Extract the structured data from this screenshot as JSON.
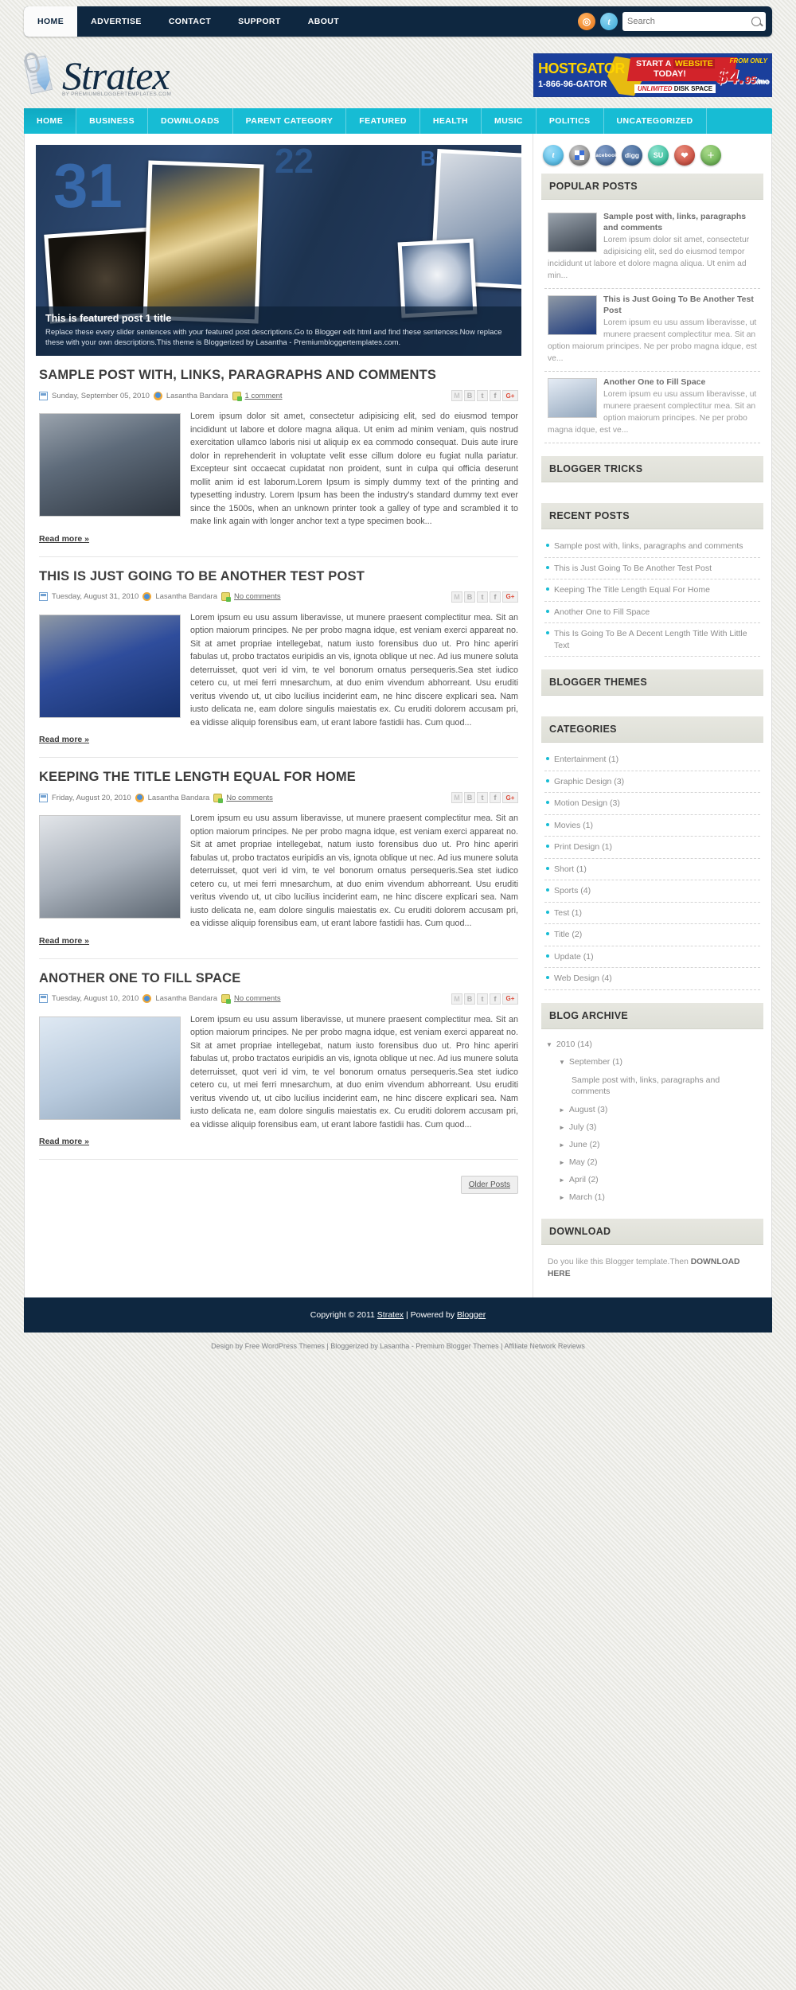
{
  "topbar": {
    "nav": [
      {
        "label": "HOME",
        "active": true
      },
      {
        "label": "ADVERTISE",
        "active": false
      },
      {
        "label": "CONTACT",
        "active": false
      },
      {
        "label": "SUPPORT",
        "active": false
      },
      {
        "label": "ABOUT",
        "active": false
      }
    ],
    "icons": [
      "rss-icon",
      "twitter-icon"
    ],
    "search": {
      "placeholder": "Search",
      "value": ""
    }
  },
  "header": {
    "logo_name": "Stratex",
    "logo_tagline": "BY PREMIUMBLOGGERTEMPLATES.COM",
    "banner": {
      "brand": "HOSTGATOR",
      "phone": "1-866-96-GATOR",
      "headline_1": "START A",
      "headline_highlight": "WEBSITE",
      "headline_2": "TODAY!",
      "sub_1": "UNLIMITED",
      "sub_2": "DISK SPACE",
      "from_only": "FROM ONLY",
      "price": "$4.",
      "cents": "95",
      "per": "/mo"
    }
  },
  "mainnav": [
    {
      "label": "HOME",
      "active": true
    },
    {
      "label": "BUSINESS",
      "active": false
    },
    {
      "label": "DOWNLOADS",
      "active": false
    },
    {
      "label": "PARENT CATEGORY",
      "active": false
    },
    {
      "label": "FEATURED",
      "active": false
    },
    {
      "label": "HEALTH",
      "active": false
    },
    {
      "label": "MUSIC",
      "active": false
    },
    {
      "label": "POLITICS",
      "active": false
    },
    {
      "label": "UNCATEGORIZED",
      "active": false
    }
  ],
  "slider": {
    "title": "This is featured post 1 title",
    "description": "Replace these every slider sentences with your featured post descriptions.Go to Blogger edit html and find these sentences.Now replace these with your own descriptions.This theme is Bloggerized by Lasantha - Premiumbloggertemplates.com."
  },
  "posts": [
    {
      "title": "SAMPLE POST WITH, LINKS, PARAGRAPHS AND COMMENTS",
      "date": "Sunday, September 05, 2010",
      "author": "Lasantha Bandara",
      "comments": "1 comment",
      "body": "Lorem ipsum dolor sit amet, consectetur adipisicing elit, sed do eiusmod tempor incididunt ut labore et dolore magna aliqua. Ut enim ad minim veniam, quis nostrud exercitation ullamco laboris nisi ut aliquip ex ea commodo consequat. Duis aute irure dolor in reprehenderit in voluptate velit esse cillum dolore eu fugiat nulla pariatur. Excepteur sint occaecat cupidatat non proident, sunt in culpa qui officia deserunt mollit anim id est laborum.Lorem Ipsum is simply dummy text of the printing and typesetting industry. Lorem Ipsum has been the industry's standard dummy text ever since the 1500s, when an unknown printer took a galley of type and scrambled it to make link again with longer anchor text a type specimen book...",
      "readmore": "Read more »"
    },
    {
      "title": "THIS IS JUST GOING TO BE ANOTHER TEST POST",
      "date": "Tuesday, August 31, 2010",
      "author": "Lasantha Bandara",
      "comments": "No comments",
      "body": "Lorem ipsum eu usu assum liberavisse, ut munere praesent complectitur mea. Sit an option maiorum principes. Ne per probo magna idque, est veniam exerci appareat no. Sit at amet propriae intellegebat, natum iusto forensibus duo ut. Pro hinc aperiri fabulas ut, probo tractatos euripidis an vis, ignota oblique ut nec. Ad ius munere soluta deterruisset, quot veri id vim, te vel bonorum ornatus persequeris.Sea stet iudico cetero cu, ut mei ferri mnesarchum, at duo enim vivendum abhorreant. Usu eruditi veritus vivendo ut, ut cibo lucilius inciderint eam, ne hinc discere explicari sea. Nam iusto delicata ne, eam dolore singulis maiestatis ex. Cu eruditi dolorem accusam pri, ea vidisse aliquip forensibus eam, ut erant labore fastidii has. Cum quod...",
      "readmore": "Read more »"
    },
    {
      "title": "KEEPING THE TITLE LENGTH EQUAL FOR HOME",
      "date": "Friday, August 20, 2010",
      "author": "Lasantha Bandara",
      "comments": "No comments",
      "body": "Lorem ipsum eu usu assum liberavisse, ut munere praesent complectitur mea. Sit an option maiorum principes. Ne per probo magna idque, est veniam exerci appareat no. Sit at amet propriae intellegebat, natum iusto forensibus duo ut. Pro hinc aperiri fabulas ut, probo tractatos euripidis an vis, ignota oblique ut nec. Ad ius munere soluta deterruisset, quot veri id vim, te vel bonorum ornatus persequeris.Sea stet iudico cetero cu, ut mei ferri mnesarchum, at duo enim vivendum abhorreant. Usu eruditi veritus vivendo ut, ut cibo lucilius inciderint eam, ne hinc discere explicari sea. Nam iusto delicata ne, eam dolore singulis maiestatis ex. Cu eruditi dolorem accusam pri, ea vidisse aliquip forensibus eam, ut erant labore fastidii has. Cum quod...",
      "readmore": "Read more »"
    },
    {
      "title": "ANOTHER ONE TO FILL SPACE",
      "date": "Tuesday, August 10, 2010",
      "author": "Lasantha Bandara",
      "comments": "No comments",
      "body": "Lorem ipsum eu usu assum liberavisse, ut munere praesent complectitur mea. Sit an option maiorum principes. Ne per probo magna idque, est veniam exerci appareat no. Sit at amet propriae intellegebat, natum iusto forensibus duo ut. Pro hinc aperiri fabulas ut, probo tractatos euripidis an vis, ignota oblique ut nec. Ad ius munere soluta deterruisset, quot veri id vim, te vel bonorum ornatus persequeris.Sea stet iudico cetero cu, ut mei ferri mnesarchum, at duo enim vivendum abhorreant. Usu eruditi veritus vivendo ut, ut cibo lucilius inciderint eam, ne hinc discere explicari sea. Nam iusto delicata ne, eam dolore singulis maiestatis ex. Cu eruditi dolorem accusam pri, ea vidisse aliquip forensibus eam, ut erant labore fastidii has. Cum quod...",
      "readmore": "Read more »"
    }
  ],
  "share_buttons": [
    "gmail",
    "blogger",
    "twitter",
    "facebook",
    "googleplus"
  ],
  "older_posts": "Older Posts",
  "sidebar": {
    "social": [
      "twitter",
      "delicious",
      "facebook",
      "digg",
      "stumbleupon",
      "love",
      "share-plus"
    ],
    "popular_title": "POPULAR POSTS",
    "popular": [
      {
        "title": "Sample post with, links, paragraphs and comments",
        "excerpt": "Lorem ipsum dolor sit amet, consectetur adipisicing elit, sed do eiusmod tempor incididunt ut labore et dolore magna aliqua. Ut enim ad min..."
      },
      {
        "title": "This is Just Going To Be Another Test Post",
        "excerpt": "Lorem ipsum eu usu assum liberavisse, ut munere praesent complectitur mea. Sit an option maiorum principes. Ne per probo magna idque, est ve..."
      },
      {
        "title": "Another One to Fill Space",
        "excerpt": "Lorem ipsum eu usu assum liberavisse, ut munere praesent complectitur mea. Sit an option maiorum principes. Ne per probo magna idque, est ve..."
      }
    ],
    "blogger_tricks_title": "BLOGGER TRICKS",
    "recent_title": "RECENT POSTS",
    "recent": [
      "Sample post with, links, paragraphs and comments",
      "This is Just Going To Be Another Test Post",
      "Keeping The Title Length Equal For Home",
      "Another One to Fill Space",
      "This Is Going To Be A Decent Length Title With Little Text"
    ],
    "blogger_themes_title": "BLOGGER THEMES",
    "categories_title": "CATEGORIES",
    "categories": [
      "Entertainment (1)",
      "Graphic Design (3)",
      "Motion Design (3)",
      "Movies (1)",
      "Print Design (1)",
      "Short (1)",
      "Sports (4)",
      "Test (1)",
      "Title (2)",
      "Update (1)",
      "Web Design (4)"
    ],
    "archive_title": "BLOG ARCHIVE",
    "archive": [
      {
        "level": 1,
        "marker": "▼",
        "label": "2010 (14)"
      },
      {
        "level": 2,
        "marker": "▼",
        "label": "September (1)"
      },
      {
        "level": 3,
        "marker": "",
        "label": "Sample post with, links, paragraphs and comments"
      },
      {
        "level": 2,
        "marker": "►",
        "label": "August (3)"
      },
      {
        "level": 2,
        "marker": "►",
        "label": "July (3)"
      },
      {
        "level": 2,
        "marker": "►",
        "label": "June (2)"
      },
      {
        "level": 2,
        "marker": "►",
        "label": "May (2)"
      },
      {
        "level": 2,
        "marker": "►",
        "label": "April (2)"
      },
      {
        "level": 2,
        "marker": "►",
        "label": "March (1)"
      }
    ],
    "download_title": "DOWNLOAD",
    "download_text": "Do you like this Blogger template.Then ",
    "download_link": "DOWNLOAD HERE"
  },
  "footer": {
    "copyright_pre": "Copyright © 2011 ",
    "site": "Stratex",
    "mid": " | Powered by ",
    "platform": "Blogger",
    "credits": "Design by Free WordPress Themes | Bloggerized by Lasantha - Premium Blogger Themes | Affiliate Network Reviews"
  },
  "colors": {
    "navy": "#0e2740",
    "cyan": "#17bcd4",
    "page_bg": "#e8e8e2"
  }
}
